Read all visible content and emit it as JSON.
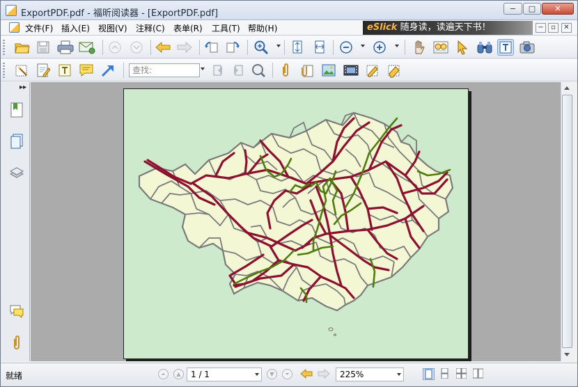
{
  "window": {
    "title": "ExportPDF.pdf - 福昕阅读器 - [ExportPDF.pdf]",
    "controls": {
      "minimize": "−",
      "maximize": "□",
      "close": "✕"
    }
  },
  "menu": {
    "items": [
      "文件(F)",
      "插入(E)",
      "视图(V)",
      "注释(C)",
      "表单(R)",
      "工具(T)",
      "帮助(H)"
    ],
    "banner_brand": "eSlick",
    "banner_text": "随身读，读遍天下书！",
    "mdi_controls": [
      "−",
      "▫",
      "✕"
    ]
  },
  "toolbar": {
    "search_placeholder": "查找:"
  },
  "status": {
    "ready_text": "就绪",
    "page_value": "1 / 1",
    "zoom_value": "225%"
  },
  "colors": {
    "page_background": "#cdebcc",
    "region_fill": "#f4f7d3",
    "border_gray": "#7a7a7a",
    "road_red": "#8c1030",
    "road_green": "#4e7c0c"
  }
}
